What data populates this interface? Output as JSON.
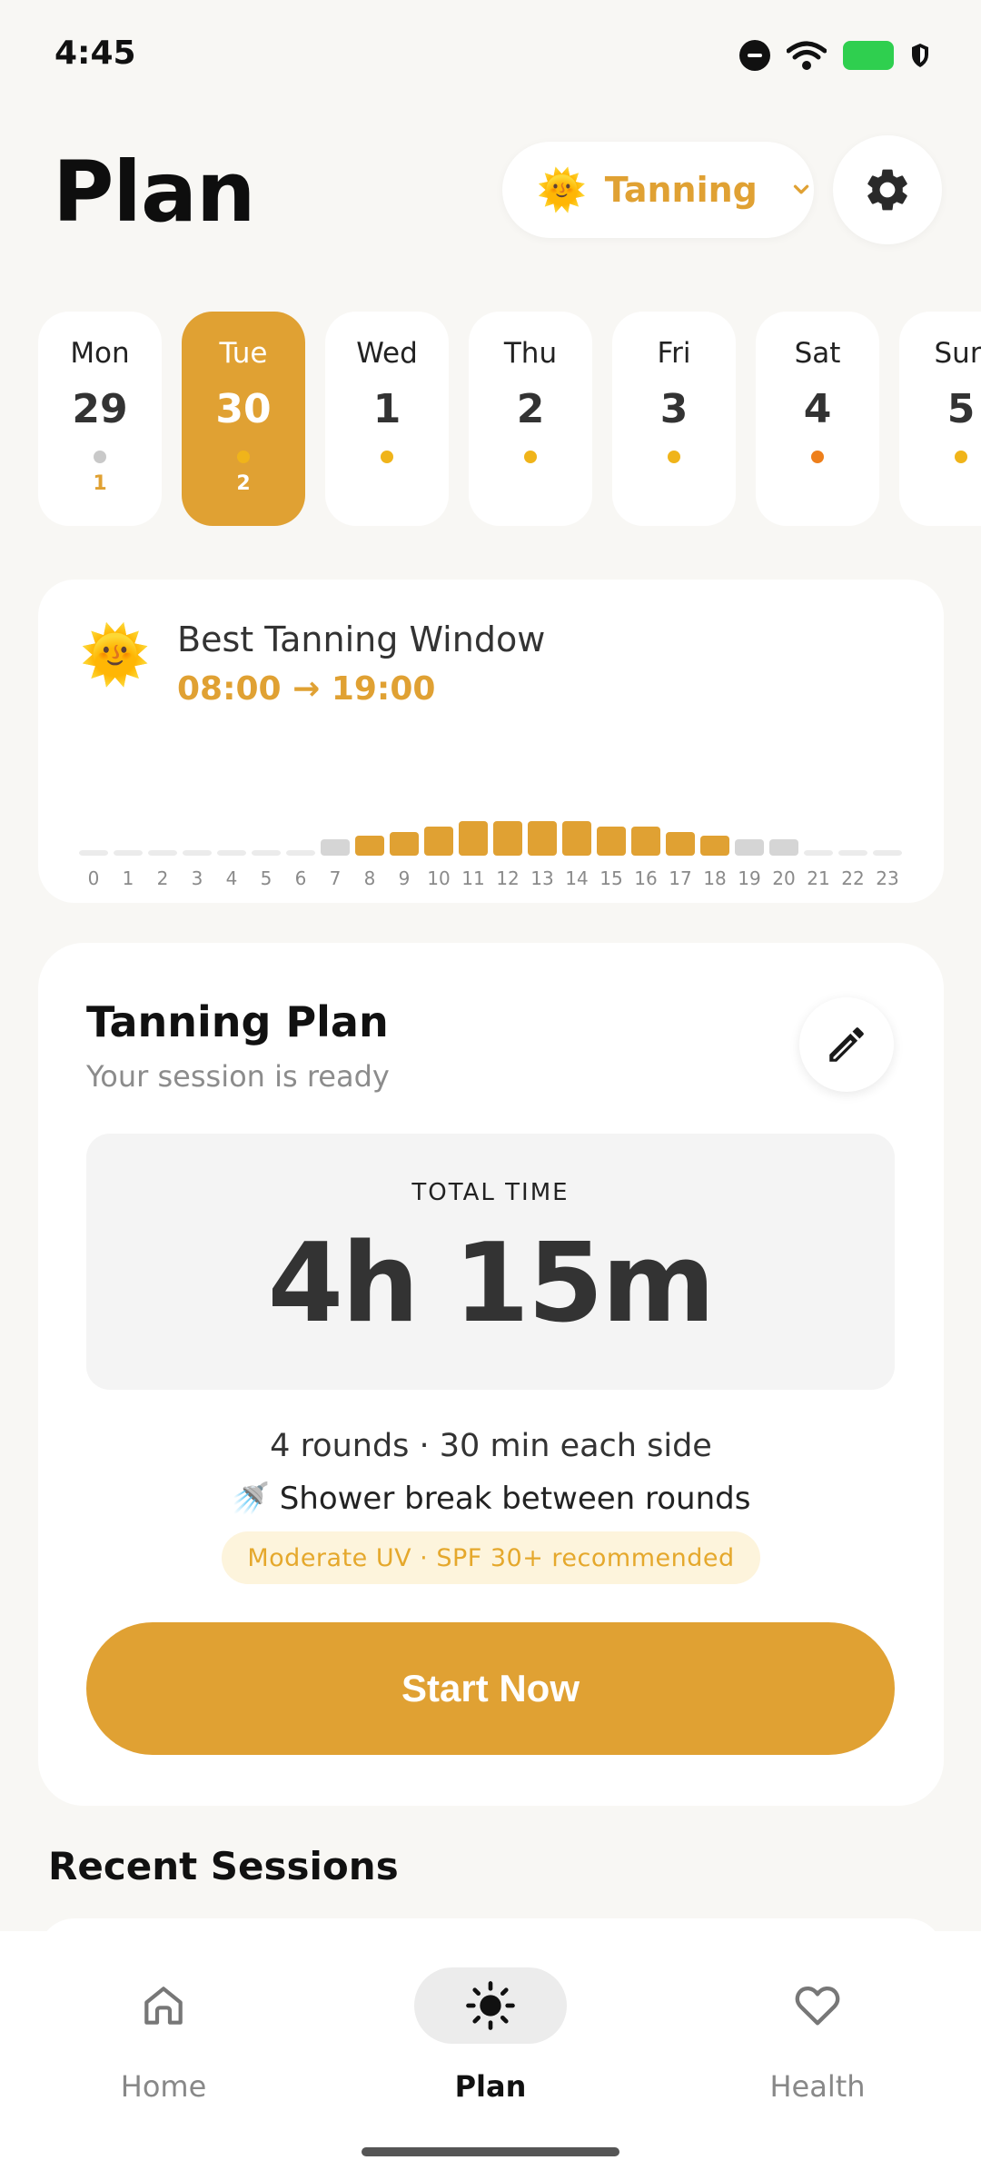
{
  "status_bar": {
    "time": "4:45"
  },
  "header": {
    "title": "Plan",
    "mode_emoji": "🌞",
    "mode_label": "Tanning",
    "icons": {
      "mode": "sun-icon",
      "settings": "gear-icon"
    }
  },
  "days": [
    {
      "name": "Mon",
      "num": "29",
      "dot": "#c9c9c9",
      "count": "1"
    },
    {
      "name": "Tue",
      "num": "30",
      "dot": "#f0b41a",
      "count": "2",
      "active": true
    },
    {
      "name": "Wed",
      "num": "1",
      "dot": "#f0b41a",
      "count": ""
    },
    {
      "name": "Thu",
      "num": "2",
      "dot": "#f0b41a",
      "count": ""
    },
    {
      "name": "Fri",
      "num": "3",
      "dot": "#f0b41a",
      "count": ""
    },
    {
      "name": "Sat",
      "num": "4",
      "dot": "#ee7f1b",
      "count": ""
    },
    {
      "name": "Sun",
      "num": "5",
      "dot": "#f0b41a",
      "count": ""
    }
  ],
  "window": {
    "emoji": "🌞",
    "title": "Best Tanning Window",
    "range": "08:00 → 19:00",
    "hours": [
      {
        "h": "0",
        "level": 0
      },
      {
        "h": "1",
        "level": 0
      },
      {
        "h": "2",
        "level": 0
      },
      {
        "h": "3",
        "level": 0
      },
      {
        "h": "4",
        "level": 0
      },
      {
        "h": "5",
        "level": 0
      },
      {
        "h": "6",
        "level": 0
      },
      {
        "h": "7",
        "level": 1
      },
      {
        "h": "8",
        "level": 2
      },
      {
        "h": "9",
        "level": 3
      },
      {
        "h": "10",
        "level": 4
      },
      {
        "h": "11",
        "level": 5
      },
      {
        "h": "12",
        "level": 5
      },
      {
        "h": "13",
        "level": 5
      },
      {
        "h": "14",
        "level": 5
      },
      {
        "h": "15",
        "level": 4
      },
      {
        "h": "16",
        "level": 4
      },
      {
        "h": "17",
        "level": 3
      },
      {
        "h": "18",
        "level": 2
      },
      {
        "h": "19",
        "level": 1
      },
      {
        "h": "20",
        "level": 1
      },
      {
        "h": "21",
        "level": 0
      },
      {
        "h": "22",
        "level": 0
      },
      {
        "h": "23",
        "level": 0
      }
    ],
    "best_start": 8,
    "best_end": 18
  },
  "plan": {
    "title": "Tanning Plan",
    "subtitle": "Your session is ready",
    "total_label": "TOTAL TIME",
    "total_value": "4h 15m",
    "rounds": "4 rounds · 30 min each side",
    "shower_emoji": "🚿",
    "shower": "Shower break between rounds",
    "uv_note": "Moderate UV · SPF 30+ recommended",
    "start_label": "Start Now",
    "icons": {
      "edit": "pencil-icon"
    }
  },
  "recent": {
    "title": "Recent Sessions"
  },
  "nav": [
    {
      "label": "Home",
      "icon": "home-icon"
    },
    {
      "label": "Plan",
      "icon": "sun-icon",
      "active": true
    },
    {
      "label": "Health",
      "icon": "heart-icon"
    }
  ],
  "colors": {
    "accent": "#e0a133",
    "inactive_bar": "#d5d5d5",
    "empty_bar": "#ebebeb"
  }
}
